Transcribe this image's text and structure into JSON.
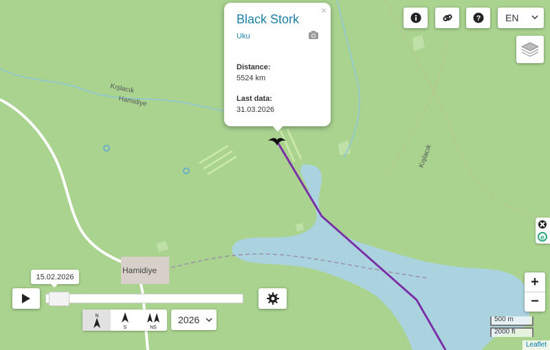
{
  "popup": {
    "title": "Black Stork",
    "close": "×",
    "bird_name": "Uku",
    "distance_label": "Distance:",
    "distance_value": "5524 km",
    "last_data_label": "Last data:",
    "last_data_value": "31.03.2026"
  },
  "map": {
    "place_names": [
      "Kışlacık",
      "Hamidiye",
      "Hamidiye",
      "Kışlacık"
    ],
    "track_color": "#7b2fa6",
    "water_color": "#aad3df",
    "land_color": "#a9d38f"
  },
  "controls": {
    "language": "EN",
    "timeline_date": "15.02.2026",
    "year": "2026",
    "timeline_position": 0.02,
    "zoom_in": "+",
    "zoom_out": "−",
    "north_buttons": [
      "N",
      "S",
      "NS"
    ]
  },
  "scale": {
    "metric": "500 m",
    "imperial": "2000 ft"
  },
  "attribution": "Leaflet",
  "icons": [
    "info-icon",
    "link-icon",
    "help-icon",
    "layers-icon",
    "camera-icon",
    "play-icon",
    "gear-icon",
    "stork-marker-icon"
  ]
}
